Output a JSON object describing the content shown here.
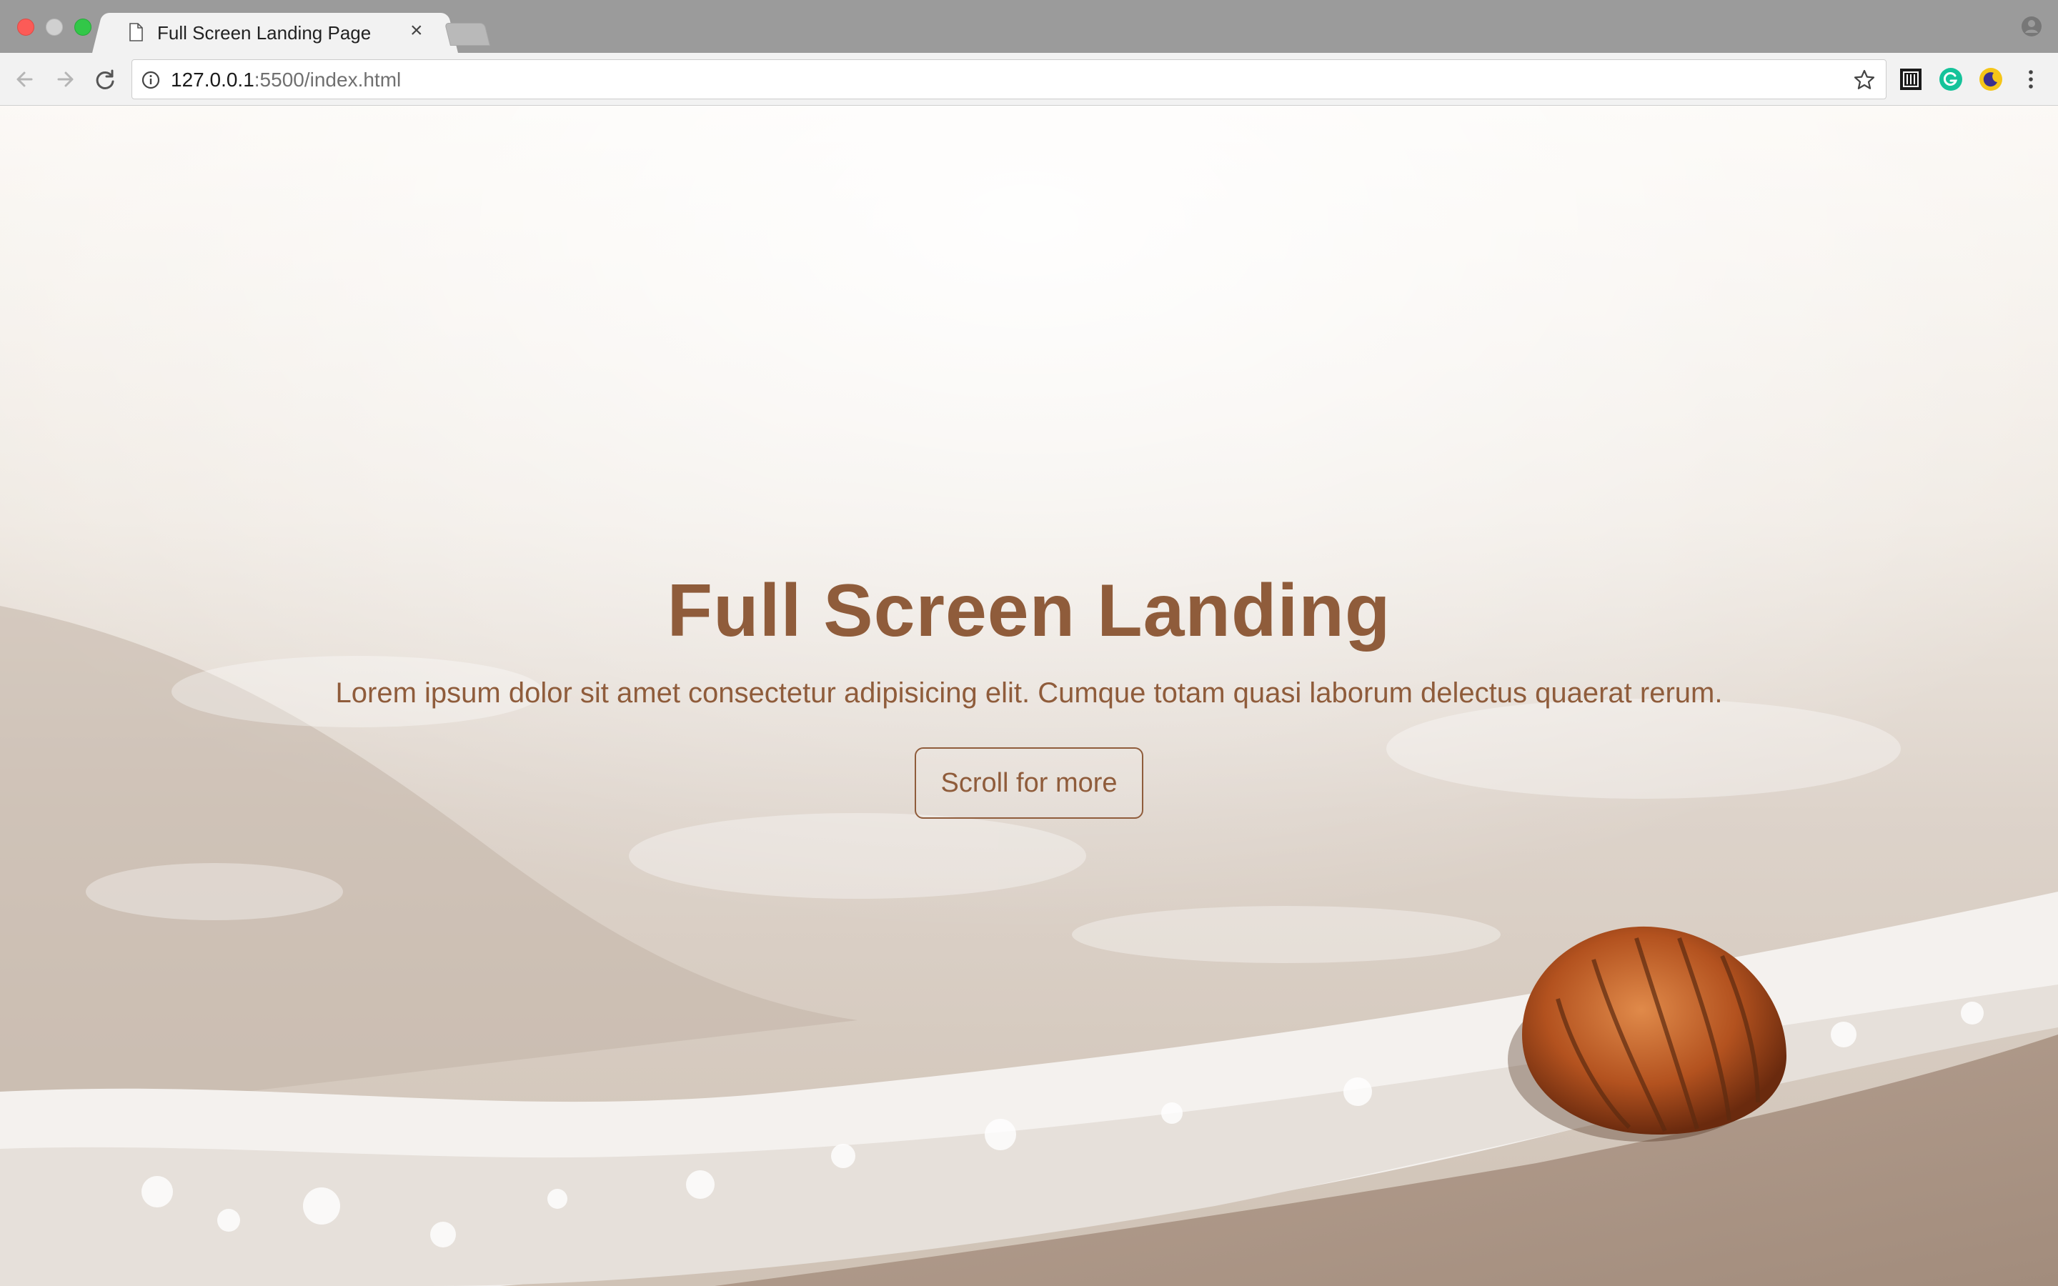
{
  "browser": {
    "tab_title": "Full Screen Landing Page",
    "tab_close": "×",
    "url_host": "127.0.0.1",
    "url_rest": ":5500/index.html"
  },
  "hero": {
    "title": "Full Screen Landing",
    "subtitle": "Lorem ipsum dolor sit amet consectetur adipisicing elit. Cumque totam quasi laborum delectus quaerat rerum.",
    "button_label": "Scroll for more"
  },
  "colors": {
    "accent": "#8f5c3b",
    "chrome": "#9b9b9b",
    "toolbar": "#f2f2f2"
  },
  "icons": [
    "page-icon",
    "close-icon",
    "profile-icon",
    "back-icon",
    "forward-icon",
    "reload-icon",
    "info-icon",
    "star-icon",
    "extension-icon",
    "grammarly-icon",
    "night-mode-icon",
    "menu-icon",
    "seashell-image"
  ]
}
